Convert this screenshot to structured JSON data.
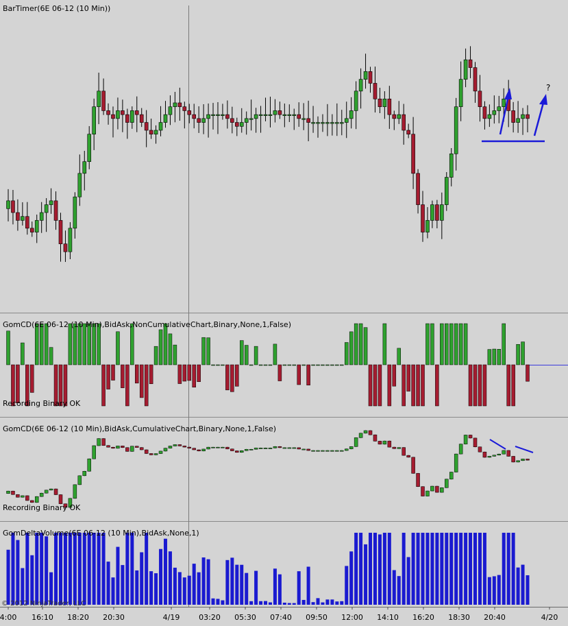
{
  "window": {
    "background": "#d4d4d4"
  },
  "panels": {
    "price": {
      "title": "BarTimer(6E 06-12 (10 Min))"
    },
    "cd_noncum": {
      "title": "GomCD(6E 06-12 (10 Min),BidAsk,NonCumulativeChart,Binary,None,1,False)",
      "status": "Recording Binary OK"
    },
    "cd_cum": {
      "title": "GomCD(6E 06-12 (10 Min),BidAsk,CumulativeChart,Binary,None,1,False)",
      "status": "Recording Binary OK"
    },
    "delta_volume": {
      "title": "GomDeltaVolume(6E 06-12 (10 Min),BidAsk,None,1)"
    }
  },
  "annotations": {
    "question_mark": "?"
  },
  "copyright": "© 2012 NinjaTrader, LLC",
  "x_axis": {
    "labels": [
      "4:00",
      "16:10",
      "18:20",
      "20:30",
      "4/19",
      "03:20",
      "05:30",
      "07:40",
      "09:50",
      "12:00",
      "14:10",
      "16:20",
      "18:30",
      "20:40",
      "4/20"
    ]
  },
  "colors": {
    "up": "#2fa12f",
    "down": "#a51c30",
    "volume": "#1a1ad0",
    "annotation": "#1a1ad8",
    "zero_line": "#3a3adc"
  },
  "chart_data": {
    "type": "candlestick",
    "instrument": "6E 06-12",
    "interval": "10 Min",
    "price_close": [
      1.3104,
      1.3101,
      1.3099,
      1.31,
      1.3097,
      1.3096,
      1.3099,
      1.3101,
      1.3103,
      1.3104,
      1.3099,
      1.3093,
      1.3091,
      1.3097,
      1.3105,
      1.3111,
      1.3114,
      1.3121,
      1.3128,
      1.3132,
      1.3127,
      1.3126,
      1.3125,
      1.3127,
      1.3126,
      1.3124,
      1.3127,
      1.3126,
      1.3124,
      1.3122,
      1.3121,
      1.3122,
      1.3124,
      1.3126,
      1.3128,
      1.3129,
      1.3128,
      1.3127,
      1.3126,
      1.3125,
      1.3124,
      1.3125,
      1.3126,
      1.3126,
      1.3126,
      1.3126,
      1.3125,
      1.3124,
      1.3123,
      1.3124,
      1.3125,
      1.3125,
      1.3126,
      1.3126,
      1.3126,
      1.3126,
      1.3127,
      1.3126,
      1.3126,
      1.3126,
      1.3126,
      1.3125,
      1.3125,
      1.3124,
      1.3124,
      1.3124,
      1.3124,
      1.3124,
      1.3124,
      1.3124,
      1.3124,
      1.3125,
      1.3127,
      1.3132,
      1.3135,
      1.3137,
      1.3134,
      1.313,
      1.3128,
      1.313,
      1.3126,
      1.3125,
      1.3126,
      1.3122,
      1.3121,
      1.3111,
      1.3103,
      1.3096,
      1.3099,
      1.3103,
      1.3099,
      1.3103,
      1.311,
      1.3116,
      1.3128,
      1.3135,
      1.314,
      1.3138,
      1.3132,
      1.3128,
      1.3125,
      1.3126,
      1.3127,
      1.3128,
      1.313,
      1.3127,
      1.3124,
      1.3125,
      1.3126,
      1.3125
    ]
  }
}
